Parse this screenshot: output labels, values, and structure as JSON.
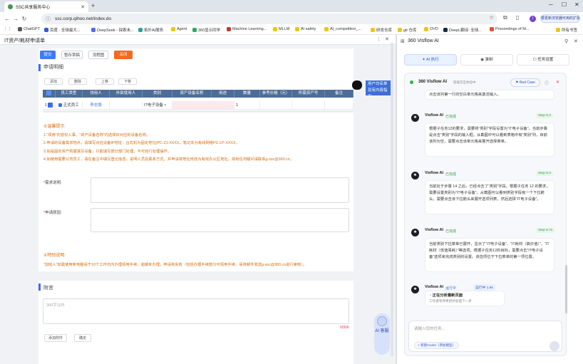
{
  "browser": {
    "tab_title": "SSC共享服务中心",
    "url": "ssc.corp.qihoo.net/index.do",
    "update_button": "要更新浏览器可用的扩展"
  },
  "bookmarks": [
    {
      "label": "ChatGPT"
    },
    {
      "label": "百度 - 全球最大..."
    },
    {
      "label": "DeepSeek - 探索未..."
    },
    {
      "label": "拓扑AI服务"
    },
    {
      "label": "Agent"
    },
    {
      "label": "360显示同学"
    },
    {
      "label": "Machine Learning..."
    },
    {
      "label": "MLLM"
    },
    {
      "label": "AI safety"
    },
    {
      "label": "AI_competition_..."
    },
    {
      "label": "研发仓库"
    },
    {
      "label": "git 仓库"
    },
    {
      "label": "OVD"
    },
    {
      "label": "DeepL翻译: 全球..."
    },
    {
      "label": "Proceedings of M..."
    }
  ],
  "bookmarks_all": "所有书签",
  "left": {
    "title": "IT资产/耗材申请单",
    "actions": [
      "提交",
      "暂存草稿",
      "流程图",
      "关闭"
    ],
    "section_applicant": "申请明细",
    "table_buttons": [
      "添加",
      "删除",
      "上移",
      "下移"
    ],
    "columns": [
      "",
      "员工类型",
      "领用人",
      "外部使用人",
      "类别",
      "资产设备名称",
      "用途",
      "数量",
      "参考价格（元）",
      "所需资产号",
      "备注"
    ],
    "row": {
      "no": "1",
      "type": "正式员工",
      "user": "李志强",
      "external": "",
      "category": "IT电子设备",
      "name": "",
      "usage": "",
      "qty": "1",
      "price": "",
      "asset": "",
      "note": ""
    },
    "tips_title": "①温馨提示:",
    "tips": [
      "1.“领用”内容仅人事、“资产设备名称”内选择好对应的设备名称。",
      "2.申请的设备需求地点，请填写对应设备IP地址：台式机为固定地址(PC-ZJ-XXXX，笔记本为有线网络PC-LP-XXXX。",
      "3.如是固定资产则需填写设备，只能填写部分部门处理，不可自行处理操作。",
      "4.如使用需要公司员工，请在备注中填写登记信息，说明人员及联系方式，并申请将地址修改为有效办公区地址，如有任何疑问请联系g-ssc@360.cn。"
    ],
    "reason_label": "需求说明:",
    "desc_label": "申请原因:",
    "notice_title": "①特别说明:",
    "notice": "“加班人”如需使用新电脑请于10个工作日内办理领用手续，逾期未办理，申请将失效（包括办理手续部分可领用手续，请将邮件发送g-ssc@360.cn进行审核）。",
    "attach_title": "附言",
    "attach_placeholder": "300字以内",
    "char_count": "0/300",
    "attach_buttons": [
      "添加附件",
      "确定"
    ],
    "float_label": "用户白名单及有内容指引",
    "ai_label": "AI 客服"
  },
  "right": {
    "title": "360 Visflow AI",
    "tabs": [
      "AI 执行",
      "录制",
      "任务设置"
    ],
    "agent_name": "360 Visflow AI",
    "agent_sub": "智能交互体验中",
    "bad_case": "Bad Case",
    "first_msg": "点击该列第一行的空白单元格来激活输入。",
    "messages": [
      {
        "name": "Visflow AI",
        "status": "已完成",
        "step": "Step 6.2",
        "text": "根据子任务12的要求，需要将“类别”字段设置为“IT电子设备”。当前步骤是点击“类别”字段的输入框。从截图中可以看到表格中有“类别”列，目前该列为空，需要点击该单元格来展开选择菜单。"
      },
      {
        "name": "Visflow AI",
        "status": "已完成",
        "step": "Step 6.3",
        "text": "当前处于步骤 14 之后，已经点击了“类别”字段。根据子任务 12 的要求，需要设置类别为“IT电子设备”。从截图可以看到类别字段有一个下拉箭头，需要点击该下拉箭头来展开选项列表，然后选择“IT电子设备”。"
      },
      {
        "name": "Visflow AI",
        "status": "已完成",
        "step": "Step 6.7s",
        "text": "当前类别下拉菜单已展开，显示了“IT电子设备”、“IT耗材（高价值）”、“IT耗材（低值易耗）”等选项。根据子任务12的目标，需要点击“IT电子设备”选项来完成类别的设置。该选项位于下拉菜单的第一项位置。"
      }
    ],
    "running": {
      "name": "Visflow AI",
      "status": "运行中",
      "step": "运行中 1.9s",
      "line1": "正在分析最新页面",
      "line2": "工作者等待更新并处理下一步"
    },
    "input_placeholder": "请输入您的任务...",
    "model_chip": "+ 新建model（添加模型）"
  }
}
